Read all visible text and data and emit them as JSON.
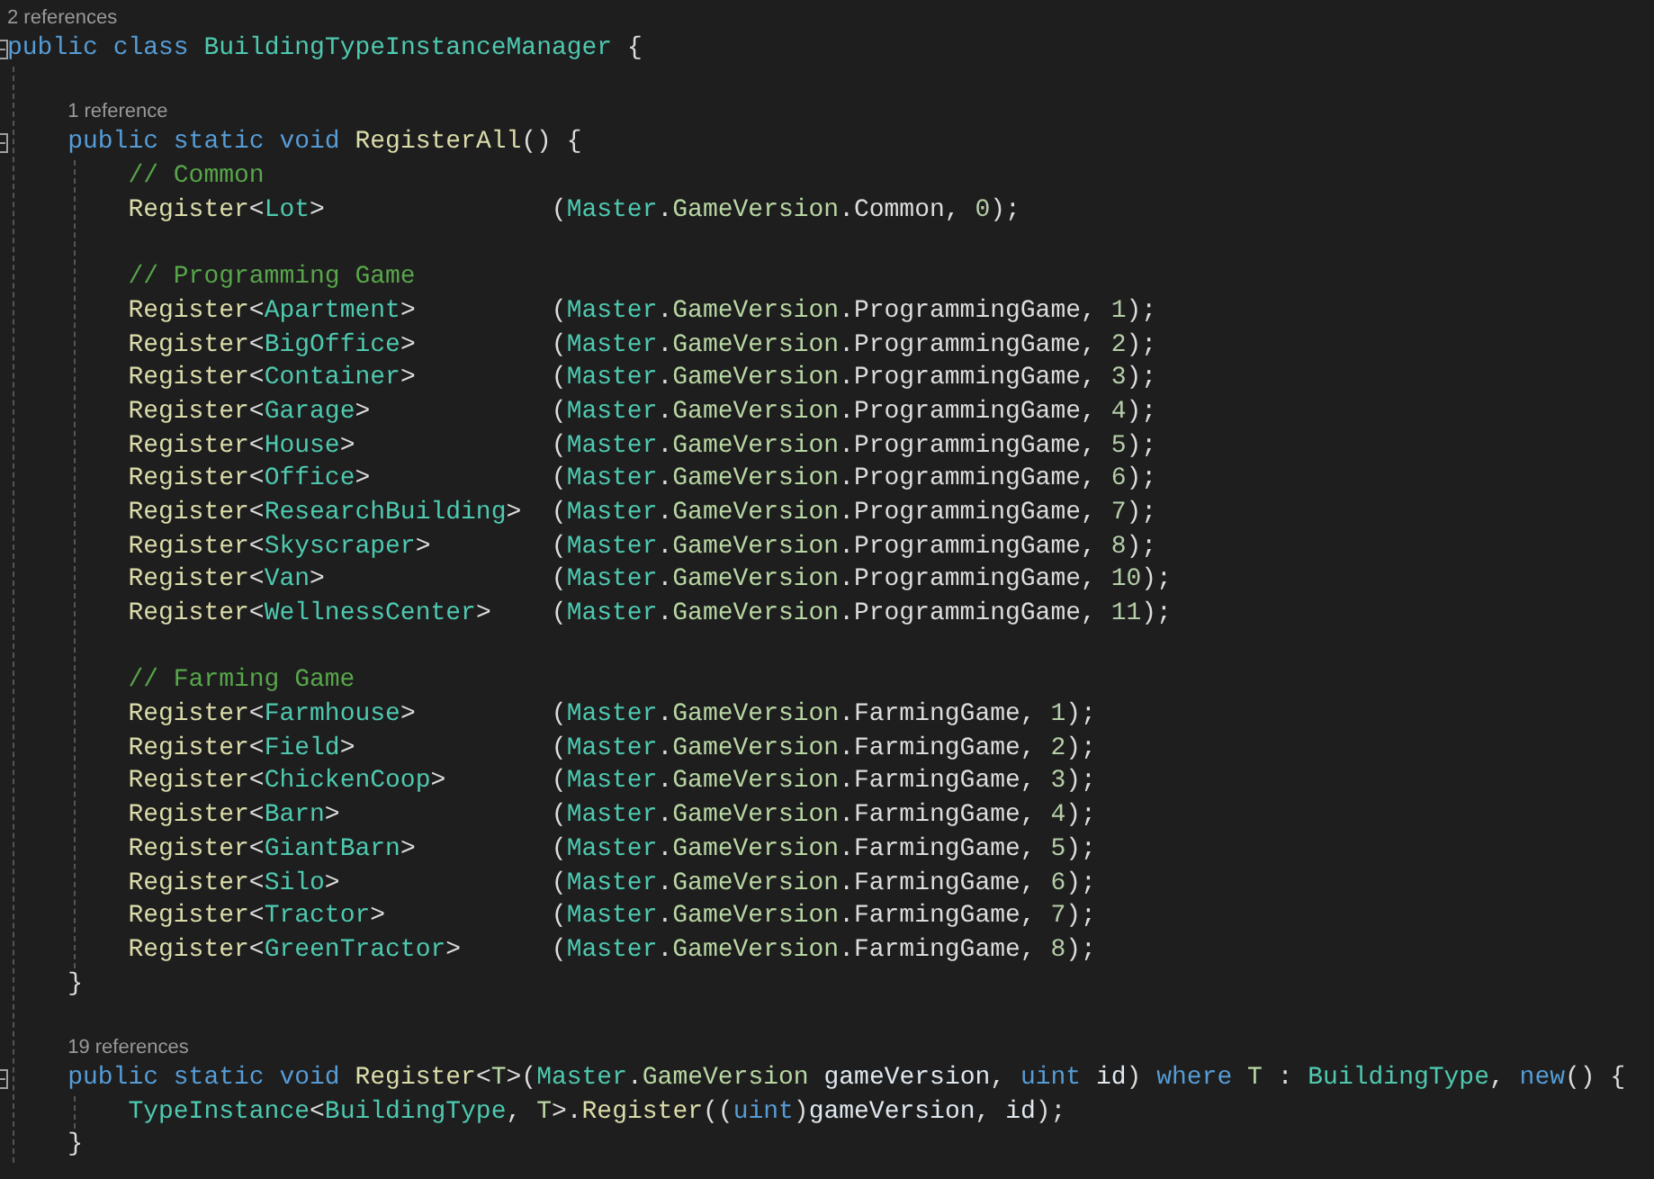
{
  "editor": {
    "blocks": [
      {
        "kind": "block",
        "lens": "2 references",
        "header": [
          {
            "text": "public ",
            "kind": "keyword"
          },
          {
            "text": "class ",
            "kind": "keyword"
          },
          {
            "text": "BuildingTypeInstanceManager",
            "kind": "type"
          },
          {
            "text": " {",
            "kind": "plain"
          }
        ],
        "body": [
          {
            "kind": "blank"
          },
          {
            "kind": "block",
            "lens": "1 reference",
            "header": [
              {
                "text": "public ",
                "kind": "keyword"
              },
              {
                "text": "static ",
                "kind": "keyword"
              },
              {
                "text": "void ",
                "kind": "keyword"
              },
              {
                "text": "RegisterAll",
                "kind": "method"
              },
              {
                "text": "() {",
                "kind": "plain"
              }
            ],
            "body": [
              {
                "kind": "code",
                "tokens": [
                  {
                    "text": "// Common",
                    "kind": "comment"
                  }
                ]
              },
              {
                "kind": "call",
                "head": [
                  {
                    "text": "Register",
                    "kind": "method"
                  },
                  {
                    "text": "<",
                    "kind": "plain"
                  },
                  {
                    "text": "Lot",
                    "kind": "type"
                  },
                  {
                    "text": ">",
                    "kind": "plain"
                  }
                ],
                "args": [
                  {
                    "text": "(",
                    "kind": "plain"
                  },
                  {
                    "text": "Master",
                    "kind": "type"
                  },
                  {
                    "text": ".",
                    "kind": "plain"
                  },
                  {
                    "text": "GameVersion",
                    "kind": "enum"
                  },
                  {
                    "text": ".Common, ",
                    "kind": "plain"
                  },
                  {
                    "text": "0",
                    "kind": "number"
                  },
                  {
                    "text": ");",
                    "kind": "plain"
                  }
                ]
              },
              {
                "kind": "blank"
              },
              {
                "kind": "code",
                "tokens": [
                  {
                    "text": "// Programming Game",
                    "kind": "comment"
                  }
                ]
              },
              {
                "kind": "call",
                "head": [
                  {
                    "text": "Register",
                    "kind": "method"
                  },
                  {
                    "text": "<",
                    "kind": "plain"
                  },
                  {
                    "text": "Apartment",
                    "kind": "type"
                  },
                  {
                    "text": ">",
                    "kind": "plain"
                  }
                ],
                "args": [
                  {
                    "text": "(",
                    "kind": "plain"
                  },
                  {
                    "text": "Master",
                    "kind": "type"
                  },
                  {
                    "text": ".",
                    "kind": "plain"
                  },
                  {
                    "text": "GameVersion",
                    "kind": "enum"
                  },
                  {
                    "text": ".ProgrammingGame, ",
                    "kind": "plain"
                  },
                  {
                    "text": "1",
                    "kind": "number"
                  },
                  {
                    "text": ");",
                    "kind": "plain"
                  }
                ]
              },
              {
                "kind": "call",
                "head": [
                  {
                    "text": "Register",
                    "kind": "method"
                  },
                  {
                    "text": "<",
                    "kind": "plain"
                  },
                  {
                    "text": "BigOffice",
                    "kind": "type"
                  },
                  {
                    "text": ">",
                    "kind": "plain"
                  }
                ],
                "args": [
                  {
                    "text": "(",
                    "kind": "plain"
                  },
                  {
                    "text": "Master",
                    "kind": "type"
                  },
                  {
                    "text": ".",
                    "kind": "plain"
                  },
                  {
                    "text": "GameVersion",
                    "kind": "enum"
                  },
                  {
                    "text": ".ProgrammingGame, ",
                    "kind": "plain"
                  },
                  {
                    "text": "2",
                    "kind": "number"
                  },
                  {
                    "text": ");",
                    "kind": "plain"
                  }
                ]
              },
              {
                "kind": "call",
                "head": [
                  {
                    "text": "Register",
                    "kind": "method"
                  },
                  {
                    "text": "<",
                    "kind": "plain"
                  },
                  {
                    "text": "Container",
                    "kind": "type"
                  },
                  {
                    "text": ">",
                    "kind": "plain"
                  }
                ],
                "args": [
                  {
                    "text": "(",
                    "kind": "plain"
                  },
                  {
                    "text": "Master",
                    "kind": "type"
                  },
                  {
                    "text": ".",
                    "kind": "plain"
                  },
                  {
                    "text": "GameVersion",
                    "kind": "enum"
                  },
                  {
                    "text": ".ProgrammingGame, ",
                    "kind": "plain"
                  },
                  {
                    "text": "3",
                    "kind": "number"
                  },
                  {
                    "text": ");",
                    "kind": "plain"
                  }
                ]
              },
              {
                "kind": "call",
                "head": [
                  {
                    "text": "Register",
                    "kind": "method"
                  },
                  {
                    "text": "<",
                    "kind": "plain"
                  },
                  {
                    "text": "Garage",
                    "kind": "type"
                  },
                  {
                    "text": ">",
                    "kind": "plain"
                  }
                ],
                "args": [
                  {
                    "text": "(",
                    "kind": "plain"
                  },
                  {
                    "text": "Master",
                    "kind": "type"
                  },
                  {
                    "text": ".",
                    "kind": "plain"
                  },
                  {
                    "text": "GameVersion",
                    "kind": "enum"
                  },
                  {
                    "text": ".ProgrammingGame, ",
                    "kind": "plain"
                  },
                  {
                    "text": "4",
                    "kind": "number"
                  },
                  {
                    "text": ");",
                    "kind": "plain"
                  }
                ]
              },
              {
                "kind": "call",
                "head": [
                  {
                    "text": "Register",
                    "kind": "method"
                  },
                  {
                    "text": "<",
                    "kind": "plain"
                  },
                  {
                    "text": "House",
                    "kind": "type"
                  },
                  {
                    "text": ">",
                    "kind": "plain"
                  }
                ],
                "args": [
                  {
                    "text": "(",
                    "kind": "plain"
                  },
                  {
                    "text": "Master",
                    "kind": "type"
                  },
                  {
                    "text": ".",
                    "kind": "plain"
                  },
                  {
                    "text": "GameVersion",
                    "kind": "enum"
                  },
                  {
                    "text": ".ProgrammingGame, ",
                    "kind": "plain"
                  },
                  {
                    "text": "5",
                    "kind": "number"
                  },
                  {
                    "text": ");",
                    "kind": "plain"
                  }
                ]
              },
              {
                "kind": "call",
                "head": [
                  {
                    "text": "Register",
                    "kind": "method"
                  },
                  {
                    "text": "<",
                    "kind": "plain"
                  },
                  {
                    "text": "Office",
                    "kind": "type"
                  },
                  {
                    "text": ">",
                    "kind": "plain"
                  }
                ],
                "args": [
                  {
                    "text": "(",
                    "kind": "plain"
                  },
                  {
                    "text": "Master",
                    "kind": "type"
                  },
                  {
                    "text": ".",
                    "kind": "plain"
                  },
                  {
                    "text": "GameVersion",
                    "kind": "enum"
                  },
                  {
                    "text": ".ProgrammingGame, ",
                    "kind": "plain"
                  },
                  {
                    "text": "6",
                    "kind": "number"
                  },
                  {
                    "text": ");",
                    "kind": "plain"
                  }
                ]
              },
              {
                "kind": "call",
                "head": [
                  {
                    "text": "Register",
                    "kind": "method"
                  },
                  {
                    "text": "<",
                    "kind": "plain"
                  },
                  {
                    "text": "ResearchBuilding",
                    "kind": "type"
                  },
                  {
                    "text": ">",
                    "kind": "plain"
                  }
                ],
                "args": [
                  {
                    "text": "(",
                    "kind": "plain"
                  },
                  {
                    "text": "Master",
                    "kind": "type"
                  },
                  {
                    "text": ".",
                    "kind": "plain"
                  },
                  {
                    "text": "GameVersion",
                    "kind": "enum"
                  },
                  {
                    "text": ".ProgrammingGame, ",
                    "kind": "plain"
                  },
                  {
                    "text": "7",
                    "kind": "number"
                  },
                  {
                    "text": ");",
                    "kind": "plain"
                  }
                ]
              },
              {
                "kind": "call",
                "head": [
                  {
                    "text": "Register",
                    "kind": "method"
                  },
                  {
                    "text": "<",
                    "kind": "plain"
                  },
                  {
                    "text": "Skyscraper",
                    "kind": "type"
                  },
                  {
                    "text": ">",
                    "kind": "plain"
                  }
                ],
                "args": [
                  {
                    "text": "(",
                    "kind": "plain"
                  },
                  {
                    "text": "Master",
                    "kind": "type"
                  },
                  {
                    "text": ".",
                    "kind": "plain"
                  },
                  {
                    "text": "GameVersion",
                    "kind": "enum"
                  },
                  {
                    "text": ".ProgrammingGame, ",
                    "kind": "plain"
                  },
                  {
                    "text": "8",
                    "kind": "number"
                  },
                  {
                    "text": ");",
                    "kind": "plain"
                  }
                ]
              },
              {
                "kind": "call",
                "head": [
                  {
                    "text": "Register",
                    "kind": "method"
                  },
                  {
                    "text": "<",
                    "kind": "plain"
                  },
                  {
                    "text": "Van",
                    "kind": "type"
                  },
                  {
                    "text": ">",
                    "kind": "plain"
                  }
                ],
                "args": [
                  {
                    "text": "(",
                    "kind": "plain"
                  },
                  {
                    "text": "Master",
                    "kind": "type"
                  },
                  {
                    "text": ".",
                    "kind": "plain"
                  },
                  {
                    "text": "GameVersion",
                    "kind": "enum"
                  },
                  {
                    "text": ".ProgrammingGame, ",
                    "kind": "plain"
                  },
                  {
                    "text": "10",
                    "kind": "number"
                  },
                  {
                    "text": ");",
                    "kind": "plain"
                  }
                ]
              },
              {
                "kind": "call",
                "head": [
                  {
                    "text": "Register",
                    "kind": "method"
                  },
                  {
                    "text": "<",
                    "kind": "plain"
                  },
                  {
                    "text": "WellnessCenter",
                    "kind": "type"
                  },
                  {
                    "text": ">",
                    "kind": "plain"
                  }
                ],
                "args": [
                  {
                    "text": "(",
                    "kind": "plain"
                  },
                  {
                    "text": "Master",
                    "kind": "type"
                  },
                  {
                    "text": ".",
                    "kind": "plain"
                  },
                  {
                    "text": "GameVersion",
                    "kind": "enum"
                  },
                  {
                    "text": ".ProgrammingGame, ",
                    "kind": "plain"
                  },
                  {
                    "text": "11",
                    "kind": "number"
                  },
                  {
                    "text": ");",
                    "kind": "plain"
                  }
                ]
              },
              {
                "kind": "blank"
              },
              {
                "kind": "code",
                "tokens": [
                  {
                    "text": "// Farming Game",
                    "kind": "comment"
                  }
                ]
              },
              {
                "kind": "call",
                "head": [
                  {
                    "text": "Register",
                    "kind": "method"
                  },
                  {
                    "text": "<",
                    "kind": "plain"
                  },
                  {
                    "text": "Farmhouse",
                    "kind": "type"
                  },
                  {
                    "text": ">",
                    "kind": "plain"
                  }
                ],
                "args": [
                  {
                    "text": "(",
                    "kind": "plain"
                  },
                  {
                    "text": "Master",
                    "kind": "type"
                  },
                  {
                    "text": ".",
                    "kind": "plain"
                  },
                  {
                    "text": "GameVersion",
                    "kind": "enum"
                  },
                  {
                    "text": ".FarmingGame, ",
                    "kind": "plain"
                  },
                  {
                    "text": "1",
                    "kind": "number"
                  },
                  {
                    "text": ");",
                    "kind": "plain"
                  }
                ]
              },
              {
                "kind": "call",
                "head": [
                  {
                    "text": "Register",
                    "kind": "method"
                  },
                  {
                    "text": "<",
                    "kind": "plain"
                  },
                  {
                    "text": "Field",
                    "kind": "type"
                  },
                  {
                    "text": ">",
                    "kind": "plain"
                  }
                ],
                "args": [
                  {
                    "text": "(",
                    "kind": "plain"
                  },
                  {
                    "text": "Master",
                    "kind": "type"
                  },
                  {
                    "text": ".",
                    "kind": "plain"
                  },
                  {
                    "text": "GameVersion",
                    "kind": "enum"
                  },
                  {
                    "text": ".FarmingGame, ",
                    "kind": "plain"
                  },
                  {
                    "text": "2",
                    "kind": "number"
                  },
                  {
                    "text": ");",
                    "kind": "plain"
                  }
                ]
              },
              {
                "kind": "call",
                "head": [
                  {
                    "text": "Register",
                    "kind": "method"
                  },
                  {
                    "text": "<",
                    "kind": "plain"
                  },
                  {
                    "text": "ChickenCoop",
                    "kind": "type"
                  },
                  {
                    "text": ">",
                    "kind": "plain"
                  }
                ],
                "args": [
                  {
                    "text": "(",
                    "kind": "plain"
                  },
                  {
                    "text": "Master",
                    "kind": "type"
                  },
                  {
                    "text": ".",
                    "kind": "plain"
                  },
                  {
                    "text": "GameVersion",
                    "kind": "enum"
                  },
                  {
                    "text": ".FarmingGame, ",
                    "kind": "plain"
                  },
                  {
                    "text": "3",
                    "kind": "number"
                  },
                  {
                    "text": ");",
                    "kind": "plain"
                  }
                ]
              },
              {
                "kind": "call",
                "head": [
                  {
                    "text": "Register",
                    "kind": "method"
                  },
                  {
                    "text": "<",
                    "kind": "plain"
                  },
                  {
                    "text": "Barn",
                    "kind": "type"
                  },
                  {
                    "text": ">",
                    "kind": "plain"
                  }
                ],
                "args": [
                  {
                    "text": "(",
                    "kind": "plain"
                  },
                  {
                    "text": "Master",
                    "kind": "type"
                  },
                  {
                    "text": ".",
                    "kind": "plain"
                  },
                  {
                    "text": "GameVersion",
                    "kind": "enum"
                  },
                  {
                    "text": ".FarmingGame, ",
                    "kind": "plain"
                  },
                  {
                    "text": "4",
                    "kind": "number"
                  },
                  {
                    "text": ");",
                    "kind": "plain"
                  }
                ]
              },
              {
                "kind": "call",
                "head": [
                  {
                    "text": "Register",
                    "kind": "method"
                  },
                  {
                    "text": "<",
                    "kind": "plain"
                  },
                  {
                    "text": "GiantBarn",
                    "kind": "type"
                  },
                  {
                    "text": ">",
                    "kind": "plain"
                  }
                ],
                "args": [
                  {
                    "text": "(",
                    "kind": "plain"
                  },
                  {
                    "text": "Master",
                    "kind": "type"
                  },
                  {
                    "text": ".",
                    "kind": "plain"
                  },
                  {
                    "text": "GameVersion",
                    "kind": "enum"
                  },
                  {
                    "text": ".FarmingGame, ",
                    "kind": "plain"
                  },
                  {
                    "text": "5",
                    "kind": "number"
                  },
                  {
                    "text": ");",
                    "kind": "plain"
                  }
                ]
              },
              {
                "kind": "call",
                "head": [
                  {
                    "text": "Register",
                    "kind": "method"
                  },
                  {
                    "text": "<",
                    "kind": "plain"
                  },
                  {
                    "text": "Silo",
                    "kind": "type"
                  },
                  {
                    "text": ">",
                    "kind": "plain"
                  }
                ],
                "args": [
                  {
                    "text": "(",
                    "kind": "plain"
                  },
                  {
                    "text": "Master",
                    "kind": "type"
                  },
                  {
                    "text": ".",
                    "kind": "plain"
                  },
                  {
                    "text": "GameVersion",
                    "kind": "enum"
                  },
                  {
                    "text": ".FarmingGame, ",
                    "kind": "plain"
                  },
                  {
                    "text": "6",
                    "kind": "number"
                  },
                  {
                    "text": ");",
                    "kind": "plain"
                  }
                ]
              },
              {
                "kind": "call",
                "head": [
                  {
                    "text": "Register",
                    "kind": "method"
                  },
                  {
                    "text": "<",
                    "kind": "plain"
                  },
                  {
                    "text": "Tractor",
                    "kind": "type"
                  },
                  {
                    "text": ">",
                    "kind": "plain"
                  }
                ],
                "args": [
                  {
                    "text": "(",
                    "kind": "plain"
                  },
                  {
                    "text": "Master",
                    "kind": "type"
                  },
                  {
                    "text": ".",
                    "kind": "plain"
                  },
                  {
                    "text": "GameVersion",
                    "kind": "enum"
                  },
                  {
                    "text": ".FarmingGame, ",
                    "kind": "plain"
                  },
                  {
                    "text": "7",
                    "kind": "number"
                  },
                  {
                    "text": ");",
                    "kind": "plain"
                  }
                ]
              },
              {
                "kind": "call",
                "head": [
                  {
                    "text": "Register",
                    "kind": "method"
                  },
                  {
                    "text": "<",
                    "kind": "plain"
                  },
                  {
                    "text": "GreenTractor",
                    "kind": "type"
                  },
                  {
                    "text": ">",
                    "kind": "plain"
                  }
                ],
                "args": [
                  {
                    "text": "(",
                    "kind": "plain"
                  },
                  {
                    "text": "Master",
                    "kind": "type"
                  },
                  {
                    "text": ".",
                    "kind": "plain"
                  },
                  {
                    "text": "GameVersion",
                    "kind": "enum"
                  },
                  {
                    "text": ".FarmingGame, ",
                    "kind": "plain"
                  },
                  {
                    "text": "8",
                    "kind": "number"
                  },
                  {
                    "text": ");",
                    "kind": "plain"
                  }
                ]
              }
            ],
            "footer": [
              {
                "text": "}",
                "kind": "plain"
              }
            ]
          },
          {
            "kind": "blank"
          },
          {
            "kind": "block",
            "lens": "19 references",
            "header": [
              {
                "text": "public ",
                "kind": "keyword"
              },
              {
                "text": "static ",
                "kind": "keyword"
              },
              {
                "text": "void ",
                "kind": "keyword"
              },
              {
                "text": "Register",
                "kind": "method"
              },
              {
                "text": "<",
                "kind": "plain"
              },
              {
                "text": "T",
                "kind": "enum"
              },
              {
                "text": ">(",
                "kind": "plain"
              },
              {
                "text": "Master",
                "kind": "type"
              },
              {
                "text": ".",
                "kind": "plain"
              },
              {
                "text": "GameVersion ",
                "kind": "enum"
              },
              {
                "text": "gameVersion",
                "kind": "param"
              },
              {
                "text": ", ",
                "kind": "plain"
              },
              {
                "text": "uint ",
                "kind": "keyword"
              },
              {
                "text": "id",
                "kind": "param"
              },
              {
                "text": ") ",
                "kind": "plain"
              },
              {
                "text": "where ",
                "kind": "keyword"
              },
              {
                "text": "T",
                "kind": "enum"
              },
              {
                "text": " : ",
                "kind": "plain"
              },
              {
                "text": "BuildingType",
                "kind": "type"
              },
              {
                "text": ", ",
                "kind": "plain"
              },
              {
                "text": "new",
                "kind": "keyword"
              },
              {
                "text": "() {",
                "kind": "plain"
              }
            ],
            "body": [
              {
                "kind": "code",
                "tokens": [
                  {
                    "text": "TypeInstance",
                    "kind": "type"
                  },
                  {
                    "text": "<",
                    "kind": "plain"
                  },
                  {
                    "text": "BuildingType",
                    "kind": "type"
                  },
                  {
                    "text": ", ",
                    "kind": "plain"
                  },
                  {
                    "text": "T",
                    "kind": "enum"
                  },
                  {
                    "text": ">.",
                    "kind": "plain"
                  },
                  {
                    "text": "Register",
                    "kind": "method"
                  },
                  {
                    "text": "((",
                    "kind": "plain"
                  },
                  {
                    "text": "uint",
                    "kind": "keyword"
                  },
                  {
                    "text": ")",
                    "kind": "plain"
                  },
                  {
                    "text": "gameVersion",
                    "kind": "param"
                  },
                  {
                    "text": ", ",
                    "kind": "plain"
                  },
                  {
                    "text": "id",
                    "kind": "param"
                  },
                  {
                    "text": ");",
                    "kind": "plain"
                  }
                ]
              }
            ],
            "footer": [
              {
                "text": "}",
                "kind": "plain"
              }
            ]
          }
        ]
      }
    ]
  }
}
